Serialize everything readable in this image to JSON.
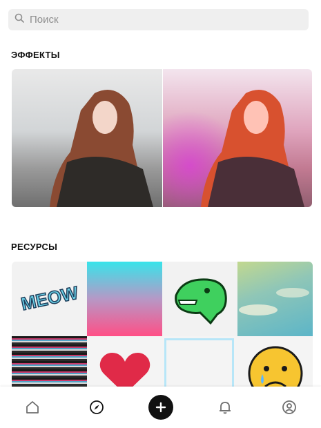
{
  "search": {
    "placeholder": "Поиск",
    "value": ""
  },
  "sections": {
    "effects": {
      "title": "ЭФФЕКТЫ"
    },
    "resources": {
      "title": "РЕСУРСЫ"
    }
  },
  "resources": {
    "meow_text": "MEOW"
  },
  "nav": {
    "items": [
      {
        "icon": "home-icon"
      },
      {
        "icon": "compass-icon"
      },
      {
        "icon": "plus-icon"
      },
      {
        "icon": "bell-icon"
      },
      {
        "icon": "profile-icon"
      }
    ]
  },
  "colors": {
    "search_bg": "#efefef",
    "nav_plus_bg": "#111111",
    "accent_cyan": "#38e4ea",
    "accent_pink": "#ff4f86"
  }
}
